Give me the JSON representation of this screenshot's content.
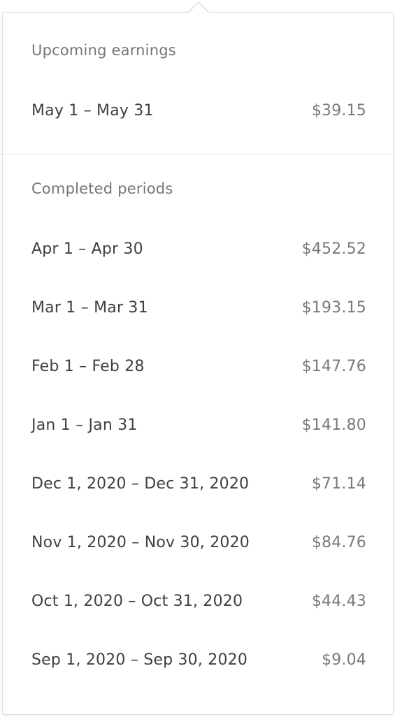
{
  "upcoming": {
    "heading": "Upcoming earnings",
    "period": "May 1 – May 31",
    "amount": "$39.15"
  },
  "completed": {
    "heading": "Completed periods",
    "periods": [
      {
        "period": "Apr 1 – Apr 30",
        "amount": "$452.52"
      },
      {
        "period": "Mar 1 – Mar 31",
        "amount": "$193.15"
      },
      {
        "period": "Feb 1 – Feb 28",
        "amount": "$147.76"
      },
      {
        "period": "Jan 1 – Jan 31",
        "amount": "$141.80"
      },
      {
        "period": "Dec 1, 2020 – Dec 31, 2020",
        "amount": "$71.14"
      },
      {
        "period": "Nov 1, 2020 – Nov 30, 2020",
        "amount": "$84.76"
      },
      {
        "period": "Oct 1, 2020 – Oct 31, 2020",
        "amount": "$44.43"
      },
      {
        "period": "Sep 1, 2020 – Sep 30, 2020",
        "amount": "$9.04"
      }
    ]
  }
}
